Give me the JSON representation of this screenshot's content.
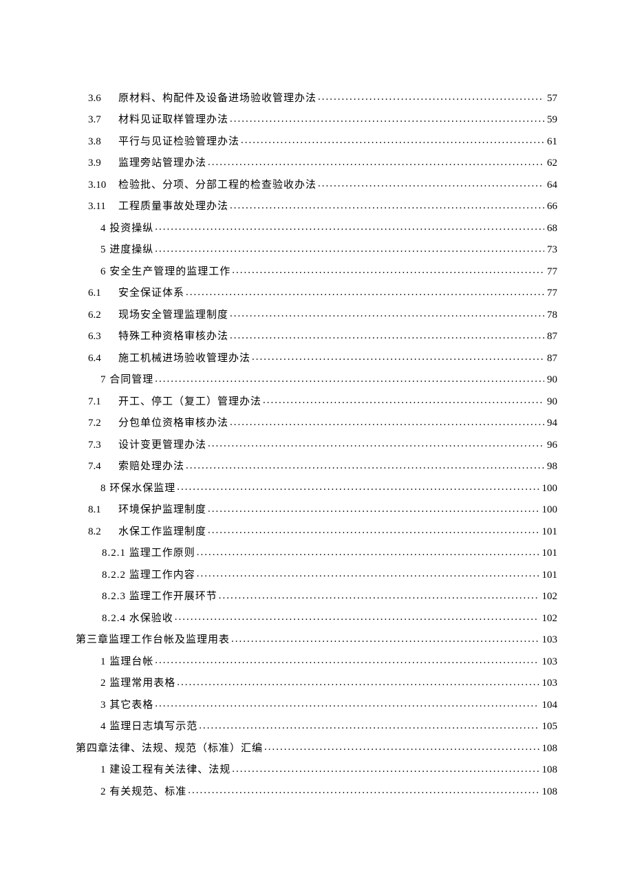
{
  "toc": [
    {
      "indent": "ind1",
      "num": "3.6",
      "title": "原材料、构配件及设备进场验收管理办法",
      "page": "57"
    },
    {
      "indent": "ind1",
      "num": "3.7",
      "title": "材料见证取样管理办法",
      "page": "59"
    },
    {
      "indent": "ind1",
      "num": "3.8",
      "title": "平行与见证检验管理办法",
      "page": "61"
    },
    {
      "indent": "ind1",
      "num": "3.9",
      "title": "监理旁站管理办法",
      "page": "62"
    },
    {
      "indent": "ind1",
      "num": "3.10",
      "title": "检验批、分项、分部工程的检查验收办法",
      "page": "64"
    },
    {
      "indent": "ind1",
      "num": "3.11",
      "title": "工程质量事故处理办法",
      "page": "66"
    },
    {
      "indent": "ind2",
      "num": "",
      "title": "4 投资操纵",
      "page": "68"
    },
    {
      "indent": "ind2",
      "num": "",
      "title": "5 进度操纵",
      "page": "73"
    },
    {
      "indent": "ind2",
      "num": "",
      "title": "6 安全生产管理的监理工作",
      "page": "77"
    },
    {
      "indent": "ind1",
      "num": "6.1",
      "title": "安全保证体系",
      "page": "77"
    },
    {
      "indent": "ind1",
      "num": "6.2",
      "title": "现场安全管理监理制度",
      "page": "78"
    },
    {
      "indent": "ind1",
      "num": "6.3",
      "title": "特殊工种资格审核办法",
      "page": "87"
    },
    {
      "indent": "ind1",
      "num": "6.4",
      "title": "施工机械进场验收管理办法",
      "page": "87"
    },
    {
      "indent": "ind2",
      "num": "",
      "title": "7 合同管理",
      "page": "90"
    },
    {
      "indent": "ind1",
      "num": "7.1",
      "title": "开工、停工（复工）管理办法",
      "page": "90"
    },
    {
      "indent": "ind1",
      "num": "7.2",
      "title": "分包单位资格审核办法",
      "page": "94"
    },
    {
      "indent": "ind1",
      "num": "7.3",
      "title": "设计变更管理办法",
      "page": "96"
    },
    {
      "indent": "ind1",
      "num": "7.4",
      "title": "索赔处理办法",
      "page": "98"
    },
    {
      "indent": "ind2",
      "num": "",
      "title": "8 环保水保监理",
      "page": "100"
    },
    {
      "indent": "ind1",
      "num": "8.1",
      "title": "环境保护监理制度",
      "page": "100"
    },
    {
      "indent": "ind1",
      "num": "8.2",
      "title": "水保工作监理制度",
      "page": "101"
    },
    {
      "indent": "ind3",
      "num": "",
      "title": "8.2.1 监理工作原则",
      "page": "101"
    },
    {
      "indent": "ind3",
      "num": "",
      "title": "8.2.2 监理工作内容",
      "page": "101"
    },
    {
      "indent": "ind3",
      "num": "",
      "title": "8.2.3 监理工作开展环节",
      "page": "102"
    },
    {
      "indent": "ind3",
      "num": "",
      "title": "8.2.4 水保验收",
      "page": "102"
    },
    {
      "indent": "ind-chapter",
      "num": "",
      "title": "第三章监理工作台帐及监理用表",
      "page": "103"
    },
    {
      "indent": "ind2",
      "num": "",
      "title": "1 监理台帐",
      "page": "103"
    },
    {
      "indent": "ind2",
      "num": "",
      "title": "2 监理常用表格",
      "page": "103"
    },
    {
      "indent": "ind2",
      "num": "",
      "title": "3 其它表格",
      "page": "104"
    },
    {
      "indent": "ind2",
      "num": "",
      "title": "4 监理日志填写示范",
      "page": "105"
    },
    {
      "indent": "ind-chapter",
      "num": "",
      "title": "第四章法律、法规、规范（标准）汇编",
      "page": "108"
    },
    {
      "indent": "ind2",
      "num": "",
      "title": "1 建设工程有关法律、法规",
      "page": "108"
    },
    {
      "indent": "ind2",
      "num": "",
      "title": "2 有关规范、标准",
      "page": "108"
    }
  ]
}
